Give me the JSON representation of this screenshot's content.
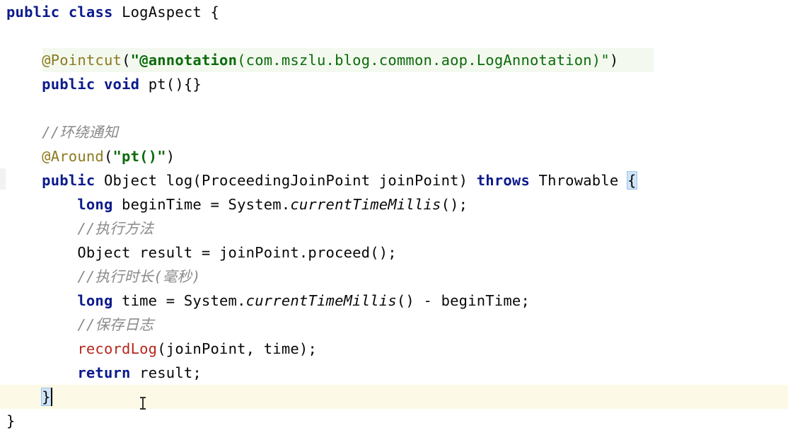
{
  "editor": {
    "lines": [
      [
        {
          "c": "kw",
          "t": "public"
        },
        {
          "c": "plain",
          "t": " "
        },
        {
          "c": "kw",
          "t": "class"
        },
        {
          "c": "plain",
          "t": " LogAspect {"
        }
      ],
      [],
      [
        {
          "c": "plain",
          "t": "    "
        },
        {
          "c": "ann",
          "t": "@Pointcut"
        },
        {
          "c": "plain",
          "t": "("
        },
        {
          "c": "strbold",
          "t": "\"@annotation"
        },
        {
          "c": "str",
          "t": "(com.mszlu.blog.common.aop.LogAnnotation)\""
        },
        {
          "c": "plain",
          "t": ")"
        }
      ],
      [
        {
          "c": "plain",
          "t": "    "
        },
        {
          "c": "kw",
          "t": "public"
        },
        {
          "c": "plain",
          "t": " "
        },
        {
          "c": "kw",
          "t": "void"
        },
        {
          "c": "plain",
          "t": " pt(){}"
        }
      ],
      [],
      [
        {
          "c": "plain",
          "t": "    "
        },
        {
          "c": "cmt",
          "t": "//环绕通知"
        }
      ],
      [
        {
          "c": "plain",
          "t": "    "
        },
        {
          "c": "ann",
          "t": "@Around"
        },
        {
          "c": "plain",
          "t": "("
        },
        {
          "c": "strbold",
          "t": "\"pt()\""
        },
        {
          "c": "plain",
          "t": ")"
        }
      ],
      [
        {
          "c": "plain",
          "t": "    "
        },
        {
          "c": "kw",
          "t": "public"
        },
        {
          "c": "plain",
          "t": " Object log(ProceedingJoinPoint joinPoint) "
        },
        {
          "c": "kw",
          "t": "throws"
        },
        {
          "c": "plain",
          "t": " Throwable "
        },
        {
          "c": "brace-hl",
          "t": "{"
        }
      ],
      [
        {
          "c": "plain",
          "t": "        "
        },
        {
          "c": "kw",
          "t": "long"
        },
        {
          "c": "plain",
          "t": " beginTime = System."
        },
        {
          "c": "static",
          "t": "currentTimeMillis"
        },
        {
          "c": "plain",
          "t": "();"
        }
      ],
      [
        {
          "c": "plain",
          "t": "        "
        },
        {
          "c": "cmt",
          "t": "//执行方法"
        }
      ],
      [
        {
          "c": "plain",
          "t": "        Object result = joinPoint.proceed();"
        }
      ],
      [
        {
          "c": "plain",
          "t": "        "
        },
        {
          "c": "cmt",
          "t": "//执行时长(毫秒)"
        }
      ],
      [
        {
          "c": "plain",
          "t": "        "
        },
        {
          "c": "kw",
          "t": "long"
        },
        {
          "c": "plain",
          "t": " time = System."
        },
        {
          "c": "static",
          "t": "currentTimeMillis"
        },
        {
          "c": "plain",
          "t": "() - beginTime;"
        }
      ],
      [
        {
          "c": "plain",
          "t": "        "
        },
        {
          "c": "cmt",
          "t": "//保存日志"
        }
      ],
      [
        {
          "c": "plain",
          "t": "        "
        },
        {
          "c": "method",
          "t": "recordLog"
        },
        {
          "c": "plain",
          "t": "(joinPoint, time);"
        }
      ],
      [
        {
          "c": "plain",
          "t": "        "
        },
        {
          "c": "kw",
          "t": "return"
        },
        {
          "c": "plain",
          "t": " result;"
        }
      ],
      [
        {
          "c": "plain",
          "t": "    "
        },
        {
          "c": "brace-hl",
          "t": "}"
        }
      ],
      [
        {
          "c": "plain",
          "t": "}"
        }
      ]
    ],
    "current_line_index": 16,
    "colors": {
      "keyword": "#0b1a8c",
      "annotation": "#8c7a1f",
      "string": "#0b6b0b",
      "comment": "#8a8a8a",
      "method_call": "#b5271d",
      "current_line": "#fcfae6",
      "brace_match": "#cfe4f7"
    },
    "icons": [
      "text-cursor-icon"
    ]
  }
}
